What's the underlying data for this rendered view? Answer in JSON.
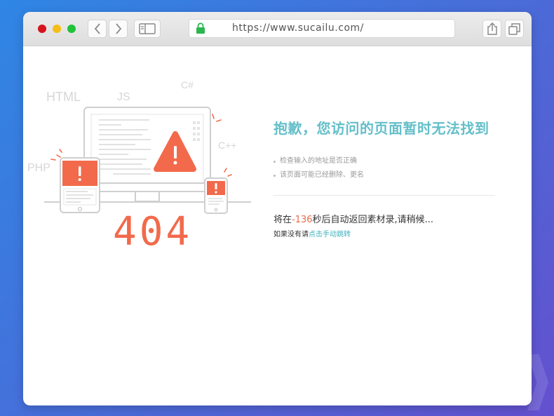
{
  "browser": {
    "url": "https://www.sucailu.com/"
  },
  "illustration": {
    "languages": [
      "HTML",
      "JS",
      "C#",
      "C++",
      "PHP"
    ],
    "error_code": "404"
  },
  "error": {
    "title": "抱歉，您访问的页面暂时无法找到",
    "tips": [
      "检查输入的地址是否正确",
      "该页面可能已经删除、更名"
    ]
  },
  "redirect": {
    "prefix": "将在",
    "countdown": "-136",
    "suffix": "秒后自动返回素材录,请稍候...",
    "manual_prefix": "如果没有请",
    "manual_link": "点击手动跳转"
  },
  "colors": {
    "accent": "#64bfc9",
    "alert": "#f26a4b",
    "link": "#3fb2bd"
  }
}
